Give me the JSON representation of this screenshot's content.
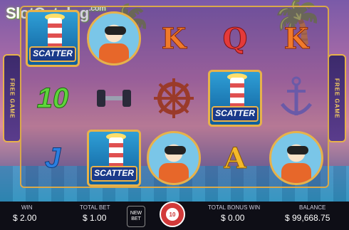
{
  "watermark": {
    "brand": "SlotCatalog",
    "suffix": ".com"
  },
  "side_panel": {
    "left_label": "FREE GAME",
    "right_label": "FREE GAME"
  },
  "symbols": {
    "scatter_label": "SCATTER"
  },
  "reels": [
    [
      "scatter",
      "10",
      "J"
    ],
    [
      "sailor",
      "dumbbell",
      "scatter"
    ],
    [
      "K",
      "wheel",
      "sailor"
    ],
    [
      "Q",
      "scatter",
      "A"
    ],
    [
      "K",
      "anchor",
      "sailor"
    ]
  ],
  "bottom_bar": {
    "win_label": "WIN",
    "win_value": "$ 2.00",
    "total_bet_label": "TOTAL BET",
    "total_bet_value": "$ 1.00",
    "new_bet_label": "NEW BET",
    "autospin_count": "10",
    "bonus_label": "TOTAL BONUS WIN",
    "bonus_value": "$ 0.00",
    "balance_label": "BALANCE",
    "balance_value": "$ 99,668.75"
  },
  "colors": {
    "accent": "#e7b24a",
    "bar_bg": "#0e0e16",
    "spin": "#d23a3a"
  }
}
